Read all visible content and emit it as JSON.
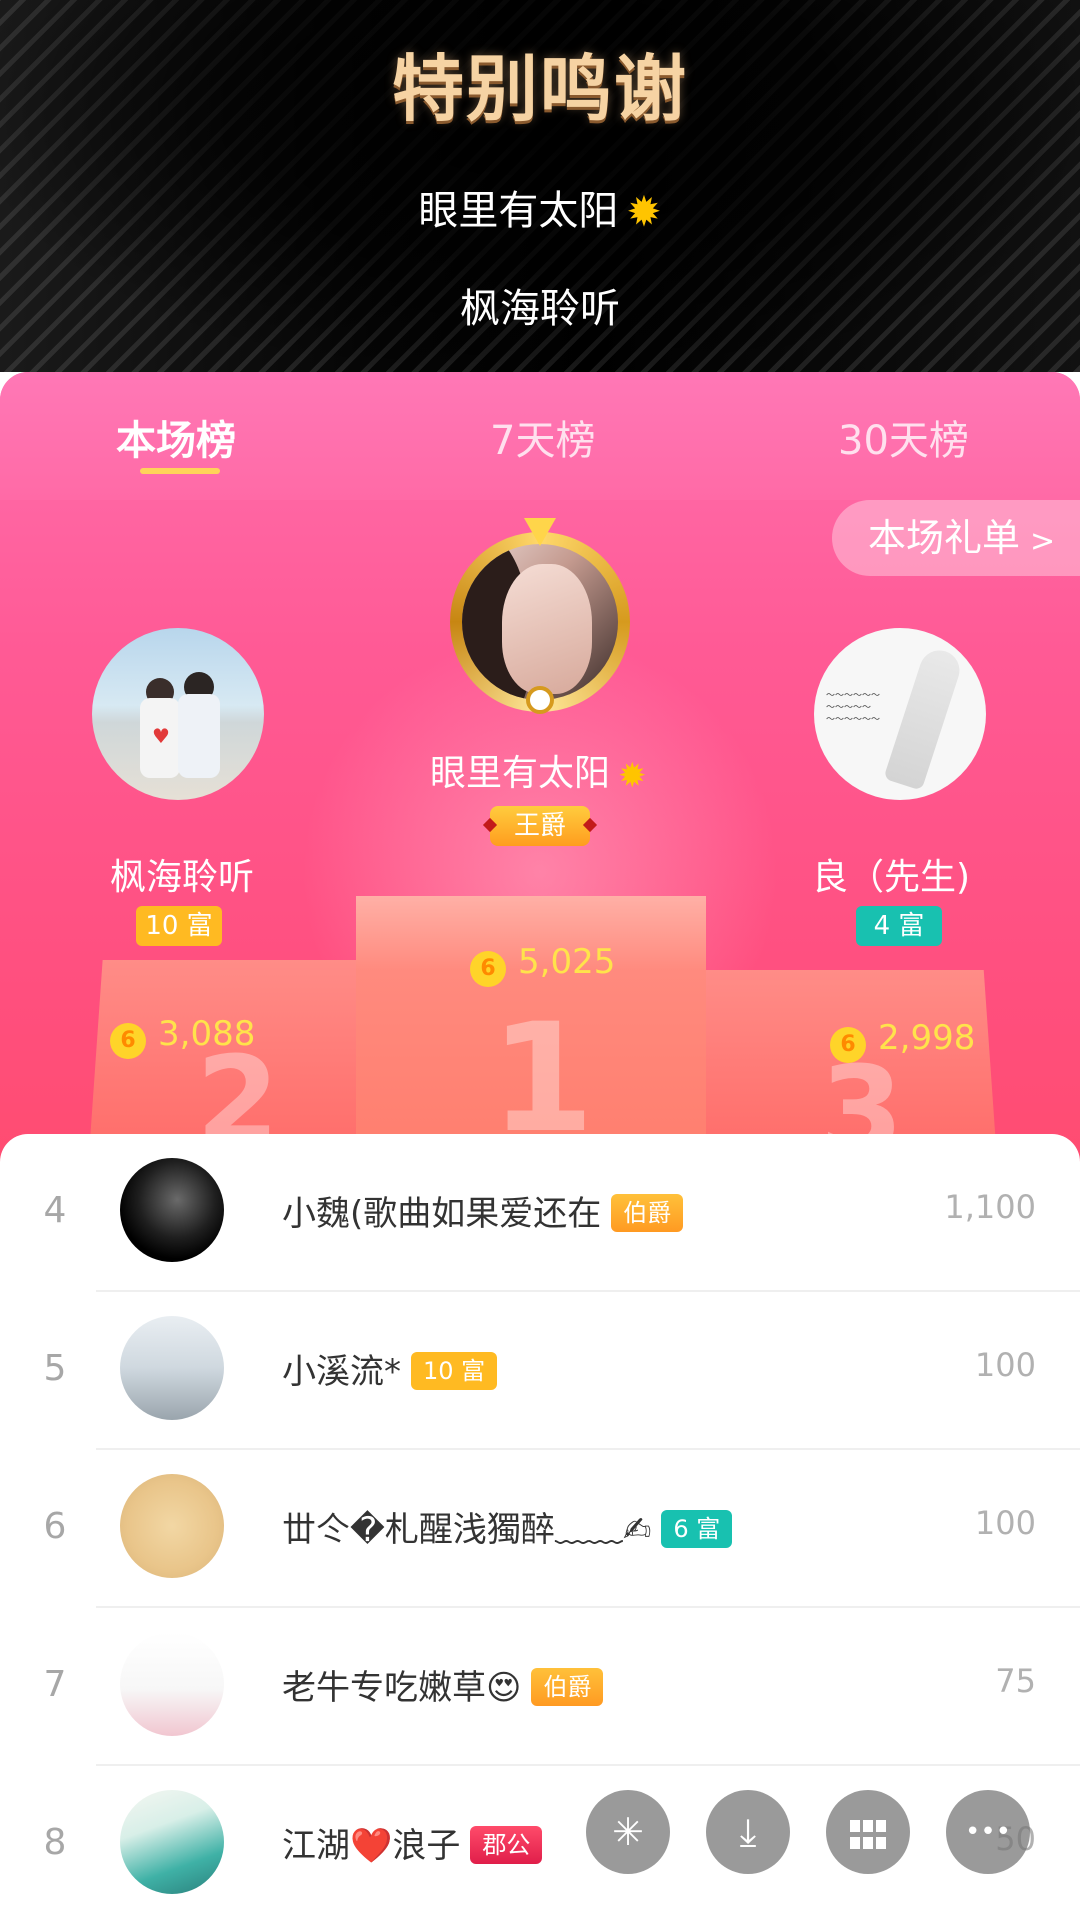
{
  "header": {
    "title": "特别鸣谢",
    "names": [
      "眼里有太阳",
      "枫海聆听"
    ]
  },
  "tabs": [
    {
      "label": "本场榜"
    },
    {
      "label": "7天榜"
    },
    {
      "label": "30天榜"
    }
  ],
  "gift_list_button": "本场礼单",
  "top3": {
    "first": {
      "name": "眼里有太阳",
      "badge": "王爵",
      "score": "5,025",
      "podium_label": "1"
    },
    "second": {
      "name": "枫海聆听",
      "badge": "10 富",
      "score": "3,088",
      "podium_label": "2"
    },
    "third": {
      "name": "良（先生)",
      "badge": "4 富",
      "score": "2,998",
      "podium_label": "3"
    }
  },
  "coin_symbol": "6",
  "list": [
    {
      "rank": "4",
      "name": "小魏(歌曲如果爱还在",
      "badge": "伯爵",
      "score": "1,100"
    },
    {
      "rank": "5",
      "name": "小溪流*",
      "badge": "10 富",
      "score": "100"
    },
    {
      "rank": "6",
      "name": "丗仒�札醒浅獨醉﹏﹏✍",
      "badge": "6 富",
      "score": "100"
    },
    {
      "rank": "7",
      "name": "老牛专吃嫩草😍",
      "badge": "伯爵",
      "score": "75"
    },
    {
      "rank": "8",
      "name": "江湖❤️浪子",
      "badge": "郡公",
      "score": "50"
    }
  ],
  "fab": {
    "share_icon": "✳",
    "download_icon": "⤓",
    "more_icon": "•••"
  },
  "colors": {
    "accent": "#ff5a95",
    "gold": "#ffd35a",
    "teal": "#18c1b0"
  }
}
